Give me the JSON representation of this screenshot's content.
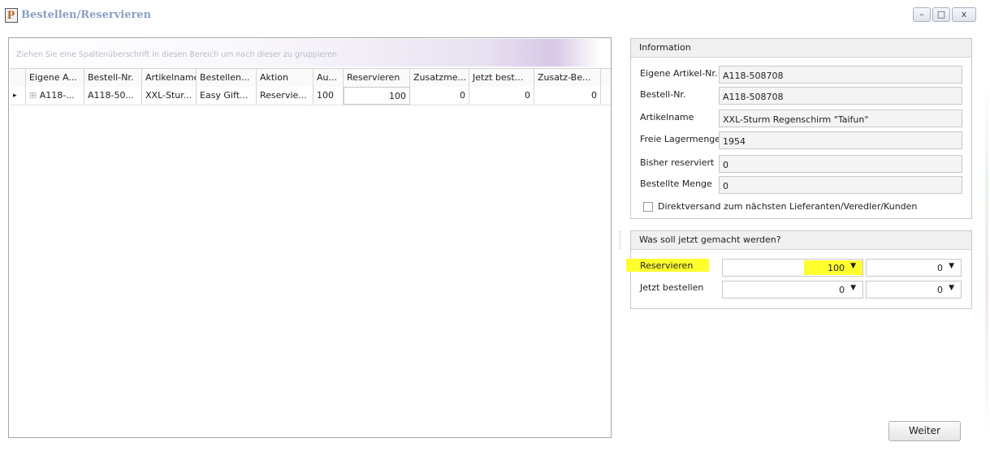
{
  "window": {
    "title": "Bestellen/Reservieren",
    "app_icon_glyph": "P",
    "buttons": {
      "minimize": "–",
      "maximize": "□",
      "close": "x"
    }
  },
  "grid": {
    "group_hint": "Ziehen Sie eine Spaltenüberschrift in diesen Bereich um nach dieser zu gruppieren",
    "columns": [
      "Eigene A...",
      "Bestell-Nr.",
      "Artikelname",
      "Bestellen...",
      "Aktion",
      "Au...",
      "Reservieren",
      "Zusatzme...",
      "Jetzt best...",
      "Zusatz-Be..."
    ],
    "rows": [
      {
        "indicator": "▸",
        "expand": "⊞",
        "cells": [
          "A118-...",
          "A118-50...",
          "XXL-Stur...",
          "Easy Gift...",
          "Reservie...",
          "100",
          "100",
          "0",
          "0",
          "0"
        ]
      }
    ]
  },
  "info": {
    "header": "Information",
    "fields": [
      {
        "label": "Eigene Artikel-Nr.",
        "value": "A118-508708"
      },
      {
        "label": "Bestell-Nr.",
        "value": "A118-508708"
      },
      {
        "label": "Artikelname",
        "value": "XXL-Sturm Regenschirm \"Taifun\""
      },
      {
        "label": "Freie Lagermenge",
        "value": "1954"
      },
      {
        "label": "Bisher reserviert",
        "value": "0"
      },
      {
        "label": "Bestellte Menge",
        "value": "0"
      }
    ],
    "checkbox_label": "Direktversand zum nächsten Lieferanten/Veredler/Kunden",
    "checkbox_checked": false
  },
  "task": {
    "header": "Was soll jetzt gemacht werden?",
    "rows": [
      {
        "label": "Reservieren",
        "value1": "100",
        "value2": "0"
      },
      {
        "label": "Jetzt bestellen",
        "value1": "0",
        "value2": "0"
      }
    ],
    "highlight_color": "#ffff2e"
  },
  "footer": {
    "next_button": "Weiter"
  }
}
